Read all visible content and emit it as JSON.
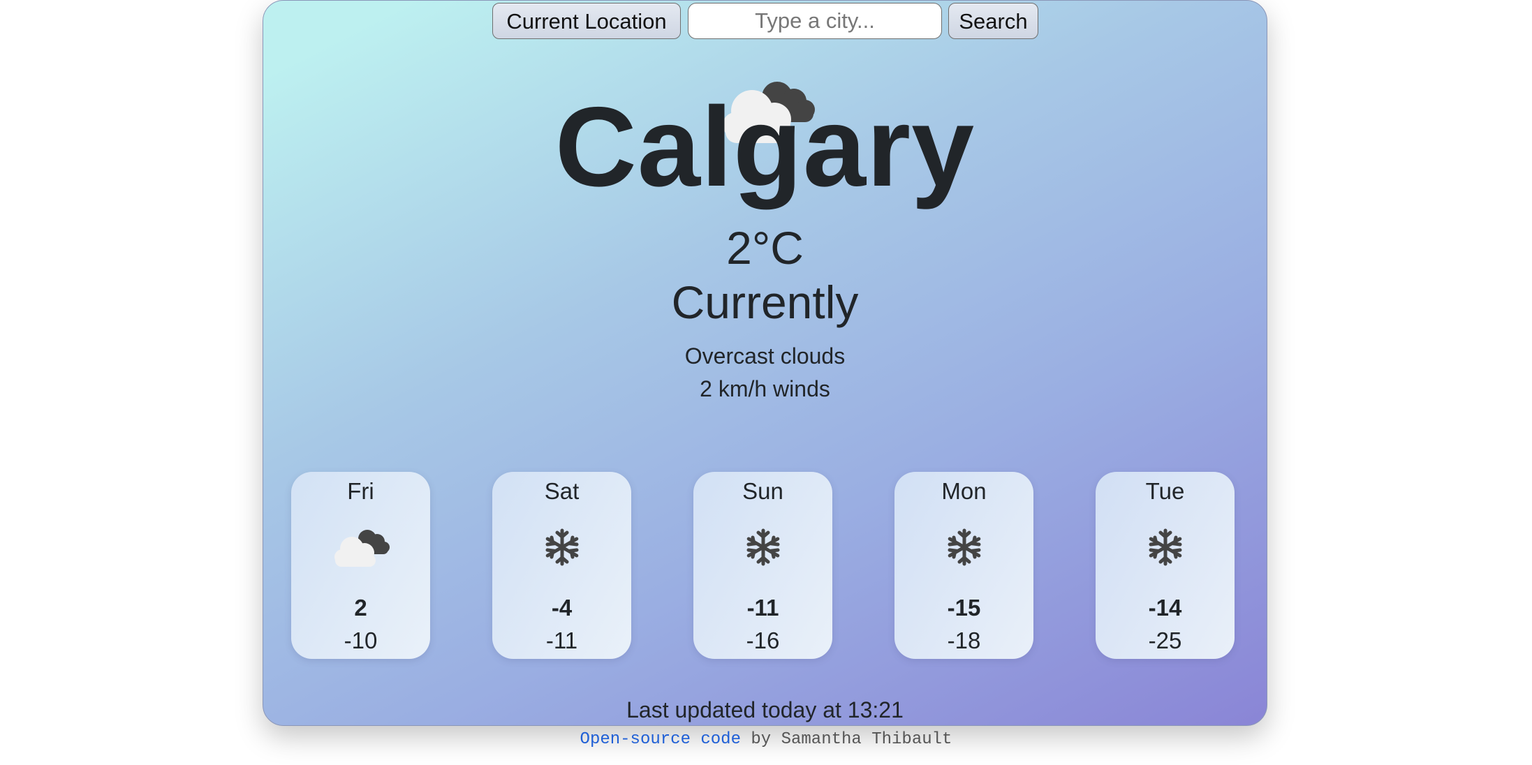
{
  "header": {
    "current_location_label": "Current Location",
    "search_placeholder": "Type a city...",
    "search_value": "",
    "search_label": "Search"
  },
  "current": {
    "city": "Calgary",
    "temperature": "2°C",
    "label": "Currently",
    "description": "Overcast clouds",
    "wind": "2 km/h winds",
    "icon": "overcast-clouds-icon"
  },
  "forecast": [
    {
      "day": "Fri",
      "high": "2",
      "low": "-10",
      "icon": "overcast-clouds-icon"
    },
    {
      "day": "Sat",
      "high": "-4",
      "low": "-11",
      "icon": "snowflake-icon"
    },
    {
      "day": "Sun",
      "high": "-11",
      "low": "-16",
      "icon": "snowflake-icon"
    },
    {
      "day": "Mon",
      "high": "-15",
      "low": "-18",
      "icon": "snowflake-icon"
    },
    {
      "day": "Tue",
      "high": "-14",
      "low": "-25",
      "icon": "snowflake-icon"
    }
  ],
  "updated": "Last updated today at 13:21",
  "footer": {
    "link_text": "Open-source code",
    "by_text": " by Samantha Thibault"
  },
  "colors": {
    "gradient_start": "#bdf0f0",
    "gradient_end": "#8a85d6",
    "link": "#1f5fd6",
    "text": "#212529"
  }
}
